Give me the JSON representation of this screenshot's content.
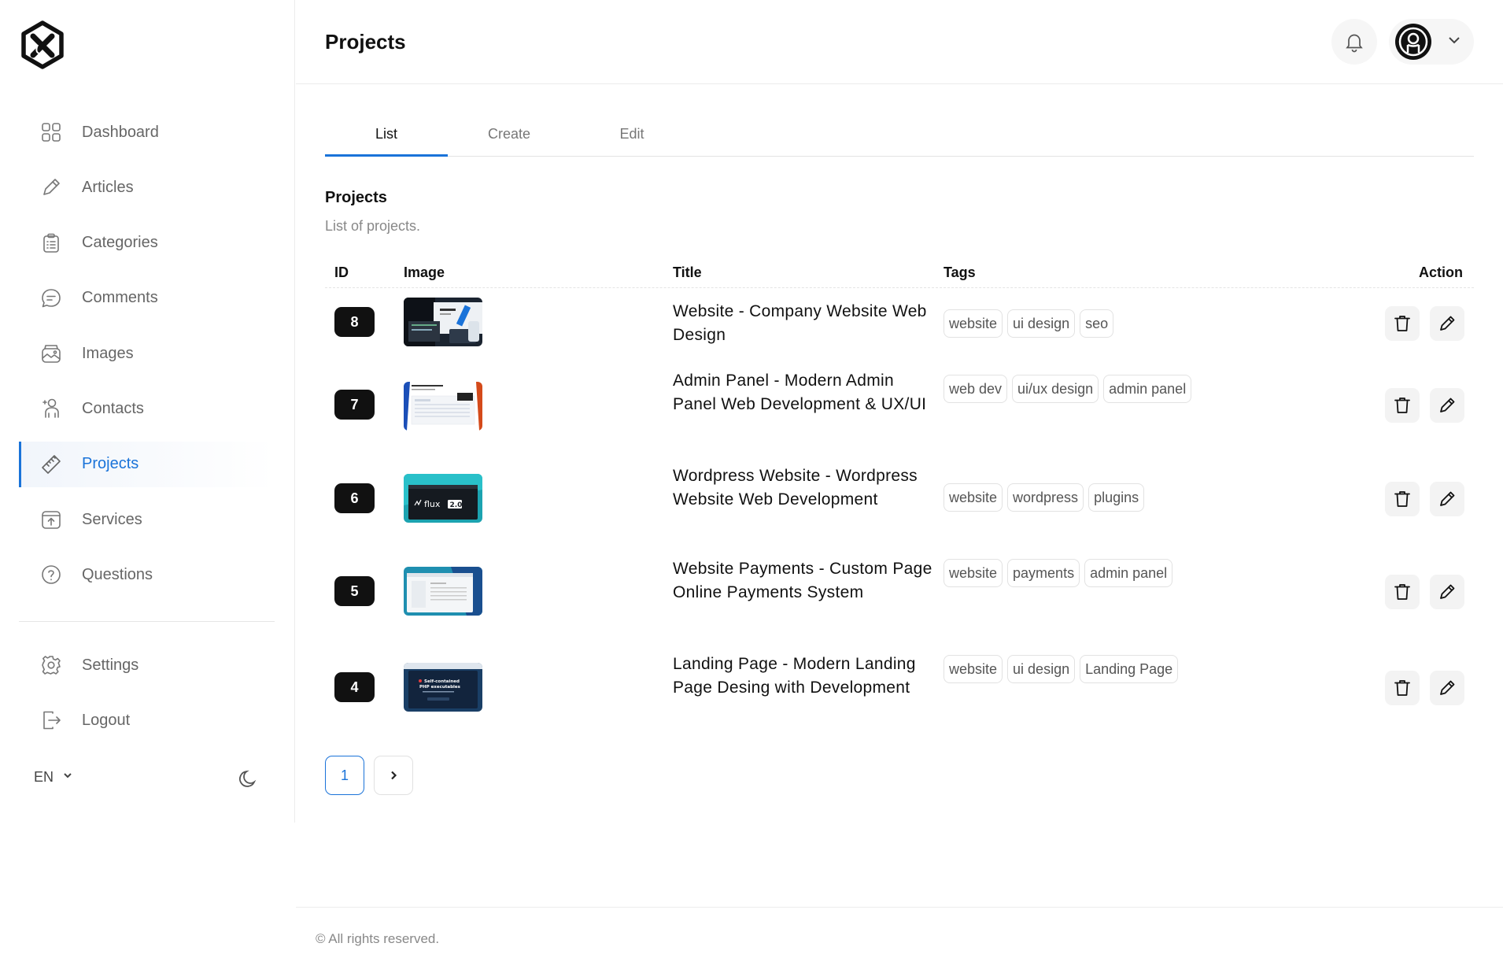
{
  "header": {
    "title": "Projects"
  },
  "sidebar": {
    "items": [
      {
        "label": "Dashboard",
        "icon": "grid-icon"
      },
      {
        "label": "Articles",
        "icon": "pencil-icon"
      },
      {
        "label": "Categories",
        "icon": "clipboard-icon"
      },
      {
        "label": "Comments",
        "icon": "chat-icon"
      },
      {
        "label": "Images",
        "icon": "image-stack-icon"
      },
      {
        "label": "Contacts",
        "icon": "person-icon"
      },
      {
        "label": "Projects",
        "icon": "ruler-icon",
        "active": true
      },
      {
        "label": "Services",
        "icon": "upload-box-icon"
      },
      {
        "label": "Questions",
        "icon": "question-icon"
      }
    ],
    "bottom": [
      {
        "label": "Settings",
        "icon": "gear-icon"
      },
      {
        "label": "Logout",
        "icon": "logout-icon"
      }
    ],
    "language": "EN"
  },
  "tabs": [
    "List",
    "Create",
    "Edit"
  ],
  "section": {
    "title": "Projects",
    "subtitle": "List of projects."
  },
  "table": {
    "headers": {
      "id": "ID",
      "image": "Image",
      "title": "Title",
      "tags": "Tags",
      "action": "Action"
    },
    "rows": [
      {
        "id": "8",
        "title": "Website - Company Website Web Design",
        "tags": [
          "website",
          "ui design",
          "seo"
        ]
      },
      {
        "id": "7",
        "title": "Admin Panel - Modern Admin Panel Web Development & UX/UI",
        "tags": [
          "web dev",
          "ui/ux design",
          "admin panel"
        ]
      },
      {
        "id": "6",
        "title": "Wordpress Website - Wordpress Website Web Development",
        "tags": [
          "website",
          "wordpress",
          "plugins"
        ]
      },
      {
        "id": "5",
        "title": "Website Payments - Custom Page Online Payments System",
        "tags": [
          "website",
          "payments",
          "admin panel"
        ]
      },
      {
        "id": "4",
        "title": "Landing Page - Modern Landing Page Desing with Development",
        "tags": [
          "website",
          "ui design",
          "Landing Page"
        ]
      }
    ]
  },
  "pagination": {
    "current": "1"
  },
  "thumb_text": {
    "flux": "flux",
    "flux_ver": "2.0",
    "php1": "Self-contained",
    "php2": "PHP executables"
  },
  "footer": "© All rights reserved.",
  "colors": {
    "accent": "#1a73d9",
    "badge": "#111111"
  }
}
